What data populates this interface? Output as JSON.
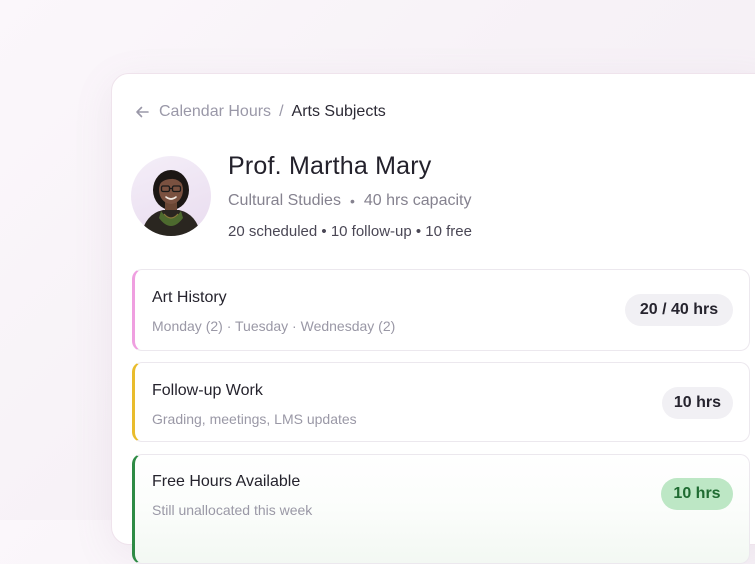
{
  "breadcrumb": {
    "parent": "Calendar Hours",
    "separator": "/",
    "current": "Arts Subjects"
  },
  "profile": {
    "name": "Prof. Martha Mary",
    "department": "Cultural Studies",
    "capacity": "40 hrs capacity",
    "separator_dot": "•",
    "summary": "20 scheduled • 10 follow-up • 10 free"
  },
  "cards": {
    "art_history": {
      "title": "Art History",
      "subtitle": "Monday (2) · Tuesday · Wednesday (2)",
      "hours": "20 / 40 hrs",
      "accent": "#ef9fe0"
    },
    "follow_up": {
      "title": "Follow-up Work",
      "subtitle": "Grading, meetings, LMS updates",
      "hours": "10 hrs",
      "accent": "#e9bc2c"
    },
    "free_hours": {
      "title": "Free Hours Available",
      "subtitle": "Still unallocated this week",
      "hours": "10 hrs",
      "accent": "#2e8b45",
      "badge_color": "#bde7c5"
    }
  },
  "icons": {
    "back": "arrow-left-icon",
    "avatar": "profile-photo"
  }
}
